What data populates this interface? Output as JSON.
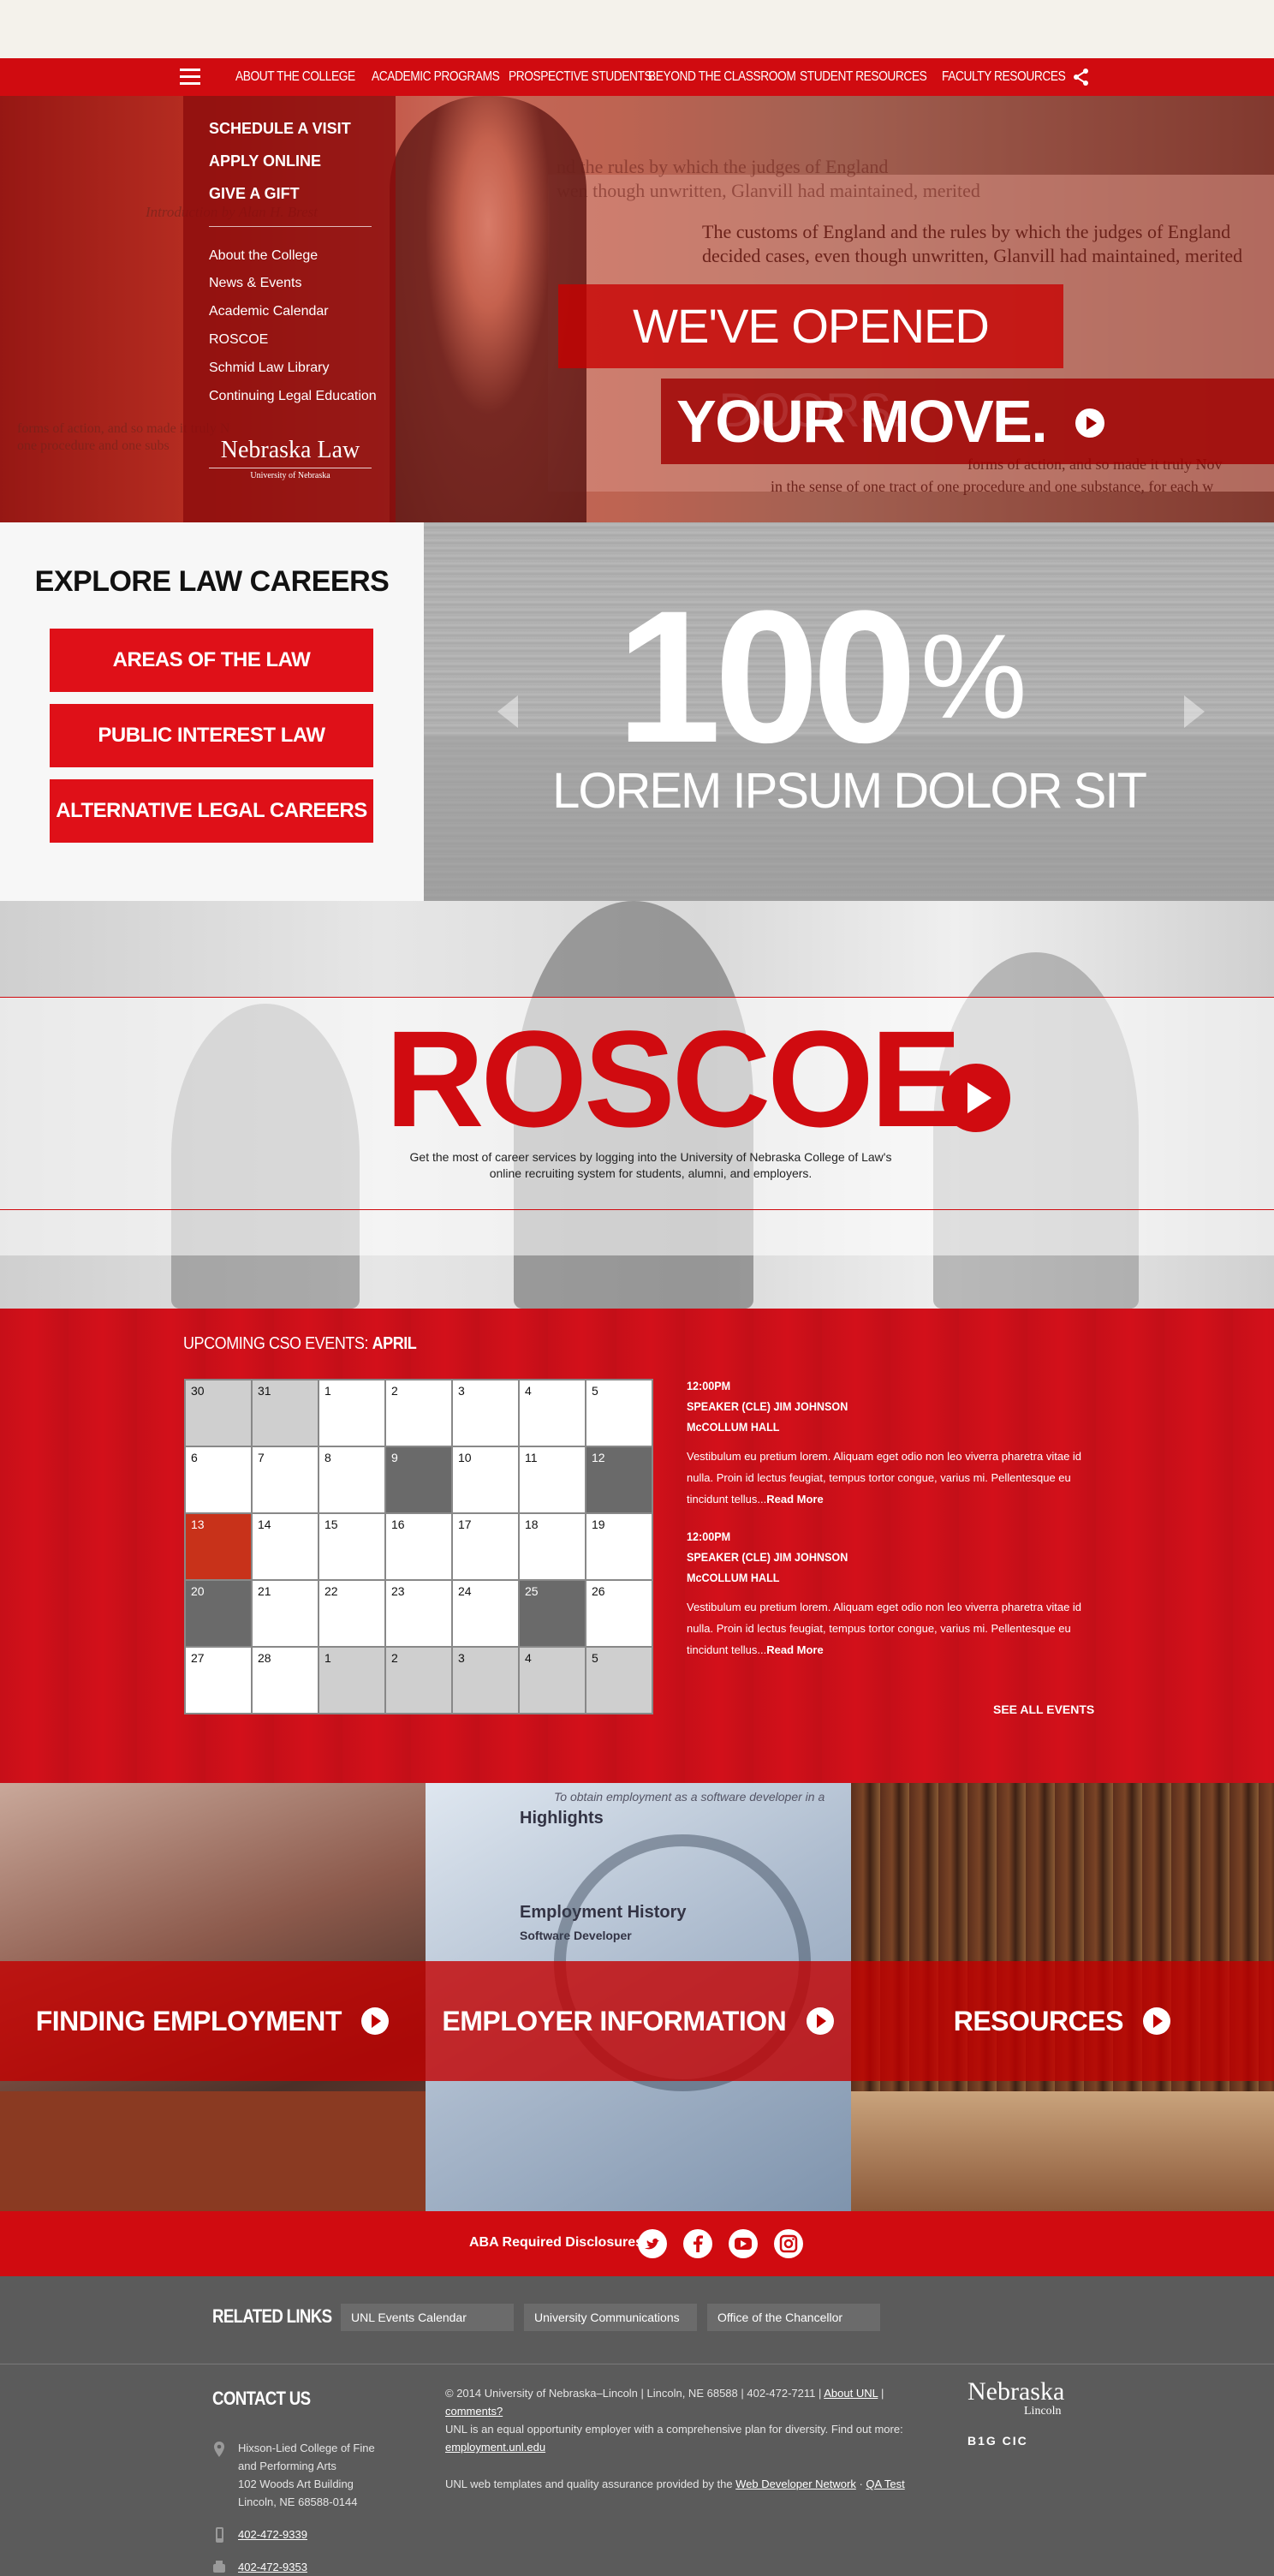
{
  "nav": {
    "items": [
      "ABOUT THE COLLEGE",
      "ACADEMIC PROGRAMS",
      "PROSPECTIVE STUDENTS",
      "BEYOND THE CLASSROOM",
      "STUDENT RESOURCES",
      "FACULTY RESOURCES"
    ],
    "menu_icon": "hamburger-icon",
    "share_icon": "share-icon"
  },
  "hero": {
    "menu_primary": [
      "SCHEDULE A VISIT",
      "APPLY ONLINE",
      "GIVE A GIFT"
    ],
    "menu_secondary": [
      "About the College",
      "News & Events",
      "Academic Calendar",
      "ROSCOE",
      "Schmid Law Library",
      "Continuing Legal Education"
    ],
    "logo_name": "Nebraska Law",
    "logo_sub": "University of Nebraska",
    "headline_1": "WE'VE OPENED DOORS.",
    "headline_2": "YOUR MOVE.",
    "background_text": [
      "nd the rules by which the judges of England",
      "wen though unwritten, Glanvill had maintained, merited",
      "The customs of England and the rules by which the judges of England",
      "decided cases, even though unwritten, Glanvill had maintained, merited",
      "forms of action, and so made it truly Nov",
      "in the sense of one tract of one procedure and one substance, for each w"
    ],
    "left_background_text": [
      "Introduction by Alan H. Brest",
      "forms of action, and so made it truly N",
      "one procedure and one subs"
    ]
  },
  "careers": {
    "title": "EXPLORE LAW CAREERS",
    "buttons": [
      "AREAS OF THE LAW",
      "PUBLIC INTEREST LAW",
      "ALTERNATIVE LEGAL CAREERS"
    ]
  },
  "stats": {
    "number": "100",
    "percent": "%",
    "caption": "LOREM IPSUM DOLOR SIT"
  },
  "roscoe": {
    "title": "ROSCOE",
    "description_line1": "Get the most of career services by logging into the University of Nebraska College of Law's",
    "description_line2": "online recruiting system for students, alumni, and employers."
  },
  "events": {
    "heading_prefix": "UPCOMING CSO EVENTS: ",
    "heading_month": "APRIL",
    "calendar": [
      {
        "d": "30",
        "s": "muted"
      },
      {
        "d": "31",
        "s": "muted"
      },
      {
        "d": "1",
        "s": ""
      },
      {
        "d": "2",
        "s": ""
      },
      {
        "d": "3",
        "s": ""
      },
      {
        "d": "4",
        "s": ""
      },
      {
        "d": "5",
        "s": ""
      },
      {
        "d": "6",
        "s": ""
      },
      {
        "d": "7",
        "s": ""
      },
      {
        "d": "8",
        "s": ""
      },
      {
        "d": "9",
        "s": "dark"
      },
      {
        "d": "10",
        "s": ""
      },
      {
        "d": "11",
        "s": ""
      },
      {
        "d": "12",
        "s": "dark"
      },
      {
        "d": "13",
        "s": "today"
      },
      {
        "d": "14",
        "s": ""
      },
      {
        "d": "15",
        "s": ""
      },
      {
        "d": "16",
        "s": ""
      },
      {
        "d": "17",
        "s": ""
      },
      {
        "d": "18",
        "s": ""
      },
      {
        "d": "19",
        "s": ""
      },
      {
        "d": "20",
        "s": "dark"
      },
      {
        "d": "21",
        "s": ""
      },
      {
        "d": "22",
        "s": ""
      },
      {
        "d": "23",
        "s": ""
      },
      {
        "d": "24",
        "s": ""
      },
      {
        "d": "25",
        "s": "dark"
      },
      {
        "d": "26",
        "s": ""
      },
      {
        "d": "27",
        "s": ""
      },
      {
        "d": "28",
        "s": ""
      },
      {
        "d": "1",
        "s": "muted"
      },
      {
        "d": "2",
        "s": "muted"
      },
      {
        "d": "3",
        "s": "muted"
      },
      {
        "d": "4",
        "s": "muted"
      },
      {
        "d": "5",
        "s": "muted"
      }
    ],
    "list": [
      {
        "time": "12:00PM",
        "title": "SPEAKER (CLE) JIM JOHNSON",
        "venue": "McCOLLUM HALL",
        "desc": "Vestibulum eu pretium lorem. Aliquam eget odio non leo viverra pharetra vitae id nulla. Proin id lectus feugiat, tempus tortor congue, varius mi. Pellentesque eu tincidunt tellus...",
        "more": "Read More"
      },
      {
        "time": "12:00PM",
        "title": "SPEAKER (CLE) JIM JOHNSON",
        "venue": "McCOLLUM HALL",
        "desc": "Vestibulum eu pretium lorem. Aliquam eget odio non leo viverra pharetra vitae id nulla. Proin id lectus feugiat, tempus tortor congue, varius mi. Pellentesque eu tincidunt tellus...",
        "more": "Read More"
      }
    ],
    "see_all": "SEE ALL EVENTS"
  },
  "tiles": [
    {
      "label": "FINDING EMPLOYMENT"
    },
    {
      "label": "EMPLOYER INFORMATION"
    },
    {
      "label": "RESOURCES"
    }
  ],
  "tile_document_text": [
    "To obtain employment as a software developer in a",
    "Highlights",
    "Employment History",
    "Software Developer"
  ],
  "disclosures": {
    "label": "ABA Required Disclosures",
    "social": [
      "twitter-icon",
      "facebook-icon",
      "youtube-icon",
      "instagram-icon"
    ]
  },
  "footer": {
    "related_title": "RELATED LINKS",
    "related_links": [
      "UNL Events Calendar",
      "University Communications",
      "Office of the Chancellor"
    ],
    "contact_title": "CONTACT US",
    "address": [
      "Hixson-Lied College of Fine",
      "and Performing Arts",
      "102 Woods Art Building",
      "Lincoln, NE 68588-0144"
    ],
    "phone": "402-472-9339",
    "fax": "402-472-9353",
    "legal_1": "© 2014 University of Nebraska–Lincoln | Lincoln, NE 68588 | 402-472-7211 |",
    "legal_1_link": "About UNL",
    "legal_1_end": "|",
    "legal_comments": "comments?",
    "legal_2": "UNL is an equal opportunity employer with a comprehensive plan for diversity. Find out more:",
    "legal_2_link": "employment.unl.edu",
    "legal_3": "UNL web templates and quality assurance provided by the",
    "legal_3_link": "Web Developer Network",
    "legal_3_sep": "·",
    "legal_3_link2": "QA Test",
    "logo_line1": "Nebraska",
    "logo_line2": "Lincoln",
    "logo_line3": "B1G  CIC"
  },
  "colors": {
    "brand_red": "#d00b10",
    "footer_gray": "#5b5b5b"
  }
}
